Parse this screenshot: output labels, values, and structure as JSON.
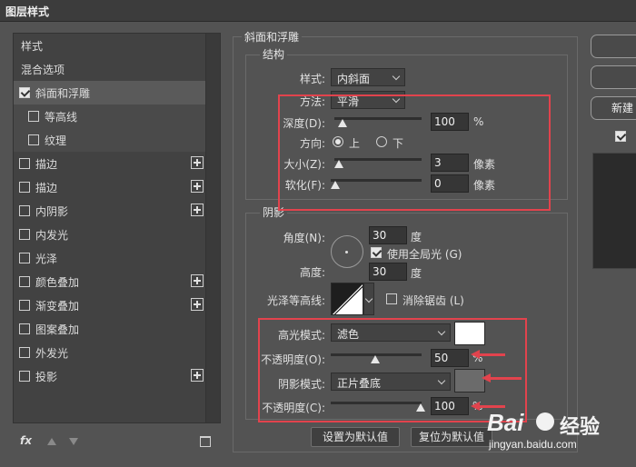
{
  "window": {
    "title": "图层样式"
  },
  "sidebar": {
    "items": [
      {
        "label": "样式",
        "checkbox": false,
        "checked": false,
        "plus": false
      },
      {
        "label": "混合选项",
        "checkbox": false,
        "checked": false,
        "plus": false
      },
      {
        "label": "斜面和浮雕",
        "checkbox": true,
        "checked": true,
        "plus": false
      },
      {
        "label": "等高线",
        "checkbox": true,
        "checked": false,
        "plus": false
      },
      {
        "label": "纹理",
        "checkbox": true,
        "checked": false,
        "plus": false
      },
      {
        "label": "描边",
        "checkbox": true,
        "checked": false,
        "plus": true
      },
      {
        "label": "描边",
        "checkbox": true,
        "checked": false,
        "plus": true
      },
      {
        "label": "内阴影",
        "checkbox": true,
        "checked": false,
        "plus": true
      },
      {
        "label": "内发光",
        "checkbox": true,
        "checked": false,
        "plus": false
      },
      {
        "label": "光泽",
        "checkbox": true,
        "checked": false,
        "plus": false
      },
      {
        "label": "颜色叠加",
        "checkbox": true,
        "checked": false,
        "plus": true
      },
      {
        "label": "渐变叠加",
        "checkbox": true,
        "checked": false,
        "plus": true
      },
      {
        "label": "图案叠加",
        "checkbox": true,
        "checked": false,
        "plus": false
      },
      {
        "label": "外发光",
        "checkbox": true,
        "checked": false,
        "plus": false
      },
      {
        "label": "投影",
        "checkbox": true,
        "checked": false,
        "plus": true
      }
    ],
    "fx_label": "fx"
  },
  "bevel": {
    "legend": "斜面和浮雕",
    "structure": {
      "legend": "结构",
      "style_label": "样式:",
      "style_value": "内斜面",
      "technique_label": "方法:",
      "technique_value": "平滑",
      "depth_label": "深度(D):",
      "depth_value": "100",
      "depth_unit": "%",
      "direction_label": "方向:",
      "direction_up": "上",
      "direction_down": "下",
      "size_label": "大小(Z):",
      "size_value": "3",
      "size_unit": "像素",
      "soften_label": "软化(F):",
      "soften_value": "0",
      "soften_unit": "像素"
    },
    "shading": {
      "legend": "阴影",
      "angle_label": "角度(N):",
      "angle_value": "30",
      "angle_unit": "度",
      "global_light_label": "使用全局光 (G)",
      "altitude_label": "高度:",
      "altitude_value": "30",
      "altitude_unit": "度",
      "gloss_contour_label": "光泽等高线:",
      "anti_alias_label": "消除锯齿 (L)",
      "highlight_mode_label": "高光模式:",
      "highlight_mode_value": "滤色",
      "highlight_opacity_label": "不透明度(O):",
      "highlight_opacity_value": "50",
      "highlight_opacity_unit": "%",
      "shadow_mode_label": "阴影模式:",
      "shadow_mode_value": "正片叠底",
      "shadow_opacity_label": "不透明度(C):",
      "shadow_opacity_value": "100",
      "shadow_opacity_unit": "%"
    },
    "make_default_label": "设置为默认值",
    "reset_default_label": "复位为默认值"
  },
  "right_buttons": {
    "new_style_label": "新建"
  },
  "watermark": {
    "brand": "Bai",
    "brand2": "经验",
    "url": "jingyan.baidu.com"
  },
  "colors": {
    "highlight": "#ffffff",
    "shadow": "#6b6b6b",
    "annotation": "#e2434d"
  }
}
